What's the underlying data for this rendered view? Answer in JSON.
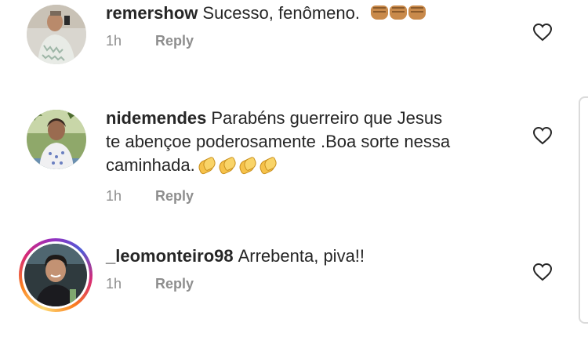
{
  "comments": [
    {
      "username": "remershow",
      "text": "Sucesso, fenômeno.",
      "emoji": [
        "fist",
        "fist",
        "fist"
      ],
      "time": "1h",
      "reply_label": "Reply"
    },
    {
      "username": "nidemendes",
      "text_line1": "Parabéns guerreiro que Jesus",
      "text_line2": "te abençoe poderosamente .Boa sorte nessa",
      "text_line3": "caminhada.",
      "emoji": [
        "clapping-hands",
        "clapping-hands",
        "clapping-hands",
        "clapping-hands"
      ],
      "time": "1h",
      "reply_label": "Reply"
    },
    {
      "username": "_leomonteiro98",
      "text": "Arrebenta, piva!!",
      "time": "1h",
      "reply_label": "Reply",
      "has_story_ring": true
    }
  ],
  "icons": {
    "like": "heart-outline-icon"
  },
  "colors": {
    "text": "#262626",
    "meta": "#8e8e8e",
    "ring_start": "#feda75",
    "ring_end": "#d62976"
  }
}
